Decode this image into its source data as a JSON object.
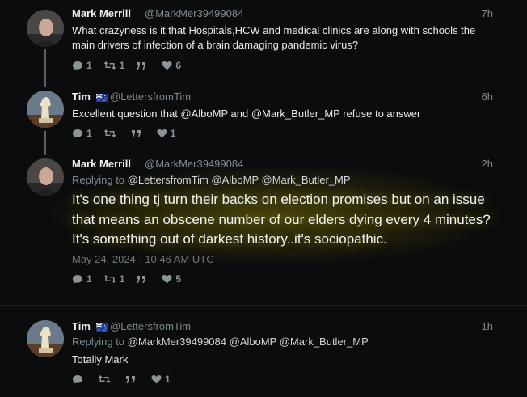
{
  "posts": [
    {
      "name": "Mark Merrill",
      "handle": "@MarkMer39499084",
      "time": "7h",
      "text": "What crazyness is it that Hospitals,HCW and medical clinics are along with schools the main drivers of infection of a brain damaging pandemic virus?",
      "reply_count": "1",
      "repost_count": "1",
      "like_count": "6"
    },
    {
      "name": "Tim",
      "handle": "@LettersfromTim",
      "time": "6h",
      "text_pre": "Excellent question that ",
      "mention1": "@AlboMP",
      "text_mid": " and ",
      "mention2": "@Mark_Butler_MP",
      "text_post": " refuse to answer",
      "reply_count": "1",
      "repost_count": "",
      "like_count": "1"
    },
    {
      "name": "Mark Merrill",
      "handle": "@MarkMer39499084",
      "time": "2h",
      "replying_label": "Replying to",
      "replying_to": [
        "@LettersfromTim",
        "@AlboMP",
        "@Mark_Butler_MP"
      ],
      "text": "It's one thing tj turn their backs on election promises but on an issue that means an obscene number of our elders dying every 4 minutes? It's something out of darkest history..it's sociopathic.",
      "date": "May 24, 2024 · 10:46 AM UTC",
      "reply_count": "1",
      "repost_count": "1",
      "like_count": "5"
    },
    {
      "name": "Tim",
      "handle": "@LettersfromTim",
      "time": "1h",
      "replying_label": "Replying to",
      "replying_to": [
        "@MarkMer39499084",
        "@AlboMP",
        "@Mark_Butler_MP"
      ],
      "text": "Totally Mark",
      "reply_count": "",
      "repost_count": "",
      "like_count": "1"
    }
  ],
  "icons": {
    "reply": "reply-icon",
    "repost": "repost-icon",
    "quote": "quote-icon",
    "like": "heart-icon",
    "flag": "australia-flag-icon"
  },
  "colors": {
    "background": "#0b0c0d",
    "muted": "#7f8a90",
    "highlight_glow": "#8c8214"
  }
}
